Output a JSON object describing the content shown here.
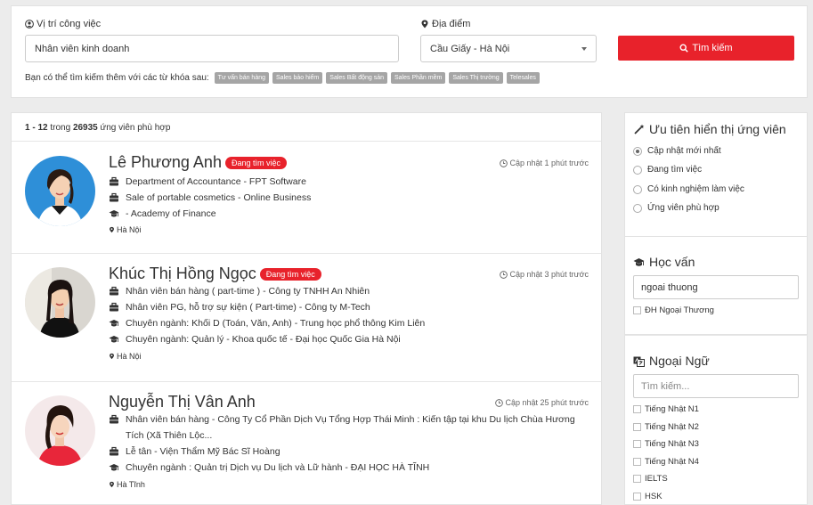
{
  "search": {
    "job_label": "Vị trí công việc",
    "job_value": "Nhân viên kinh doanh",
    "location_label": "Địa điểm",
    "location_value": "Cầu Giấy - Hà Nội",
    "button_label": "Tìm kiếm",
    "suggest_text": "Bạn có thể tìm kiếm thêm với các từ khóa sau:",
    "tags": [
      "Tư vấn bán hàng",
      "Sales bảo hiểm",
      "Sales Bất động sản",
      "Sales Phần mềm",
      "Sales Thị trường",
      "Telesales"
    ]
  },
  "results": {
    "range": "1 - 12",
    "in_word": "trong",
    "total": "26935",
    "suffix": "ứng viên phù hợp"
  },
  "candidates": [
    {
      "name": "Lê Phương Anh",
      "badge": "Đang tìm việc",
      "updated": "Cập nhật 1 phút trước",
      "lines": [
        {
          "icon": "briefcase",
          "text": "Department of Accountance - FPT Software"
        },
        {
          "icon": "briefcase",
          "text": "Sale of portable cosmetics - Online Business"
        },
        {
          "icon": "graduation-cap",
          "text": "- Academy of Finance"
        }
      ],
      "location": "Hà Nội"
    },
    {
      "name": "Khúc Thị Hồng Ngọc",
      "badge": "Đang tìm việc",
      "updated": "Cập nhật 3 phút trước",
      "lines": [
        {
          "icon": "briefcase",
          "text": "Nhân viên bán hàng ( part-time ) - Công ty TNHH An Nhiên"
        },
        {
          "icon": "briefcase",
          "text": "Nhân viên PG, hỗ trợ sự kiện ( Part-time) - Công ty M-Tech"
        },
        {
          "icon": "graduation-cap",
          "text": "Chuyên ngành: Khối D (Toán, Văn, Anh) - Trung học phổ thông Kim Liên"
        },
        {
          "icon": "graduation-cap",
          "text": "Chuyên ngành: Quản lý - Khoa quốc tế - Đại học Quốc Gia Hà Nội"
        }
      ],
      "location": "Hà Nội"
    },
    {
      "name": "Nguyễn Thị Vân Anh",
      "badge": "",
      "updated": "Cập nhật 25 phút trước",
      "lines": [
        {
          "icon": "briefcase",
          "text": "Nhân viên bán hàng - Công Ty Cổ Phần Dịch Vụ Tổng Hợp Thái Minh : Kiến tập tại khu Du lịch Chùa Hương Tích (Xã Thiên Lộc..."
        },
        {
          "icon": "briefcase",
          "text": "Lễ tân - Viện Thẩm Mỹ Bác Sĩ Hoàng"
        },
        {
          "icon": "graduation-cap",
          "text": "Chuyên ngành : Quản trị Dịch vụ Du lịch và Lữ hành - ĐẠI HỌC HÀ TĨNH"
        }
      ],
      "location": "Hà Tĩnh"
    }
  ],
  "sidebar": {
    "priority": {
      "title": "Ưu tiên hiển thị ứng viên",
      "options": [
        "Cập nhật mới nhất",
        "Đang tìm việc",
        "Có kinh nghiệm làm việc",
        "Ứng viên phù hợp"
      ],
      "selected": 0
    },
    "education": {
      "title": "Học vấn",
      "input_value": "ngoai thuong",
      "options": [
        "ĐH Ngoại Thương"
      ]
    },
    "language": {
      "title": "Ngoại Ngữ",
      "placeholder": "Tìm kiếm...",
      "options": [
        "Tiếng Nhật N1",
        "Tiếng Nhật N2",
        "Tiếng Nhật N3",
        "Tiếng Nhật N4",
        "IELTS",
        "HSK"
      ]
    }
  },
  "colors": {
    "accent": "#e8222b",
    "tag_bg": "#a5a5a5",
    "page_bg": "#ececec"
  }
}
